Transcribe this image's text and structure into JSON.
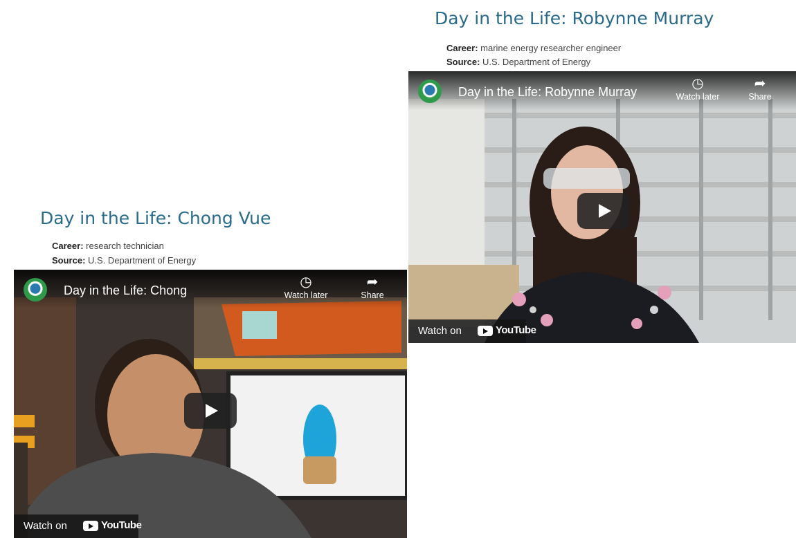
{
  "cards": [
    {
      "title": "Day in the Life: Robynne Murray",
      "career_label": "Career:",
      "career_value": "marine energy researcher engineer",
      "source_label": "Source:",
      "source_value": "U.S. Department of Energy",
      "video": {
        "title": "Day in the Life: Robynne Murray",
        "watch_later": "Watch later",
        "share": "Share",
        "watch_on": "Watch on",
        "brand": "YouTube"
      }
    },
    {
      "title": "Day in the Life: Chong Vue",
      "career_label": "Career:",
      "career_value": "research technician",
      "source_label": "Source:",
      "source_value": "U.S. Department of Energy",
      "video": {
        "title": "Day in the Life: Chong",
        "watch_later": "Watch later",
        "share": "Share",
        "watch_on": "Watch on",
        "brand": "YouTube"
      }
    }
  ],
  "colors": {
    "title": "#2b6b8a",
    "player_bg": "#111111"
  },
  "icons": [
    "clock-icon",
    "share-arrow-icon",
    "play-icon",
    "youtube-logo-icon",
    "channel-logo-icon"
  ]
}
